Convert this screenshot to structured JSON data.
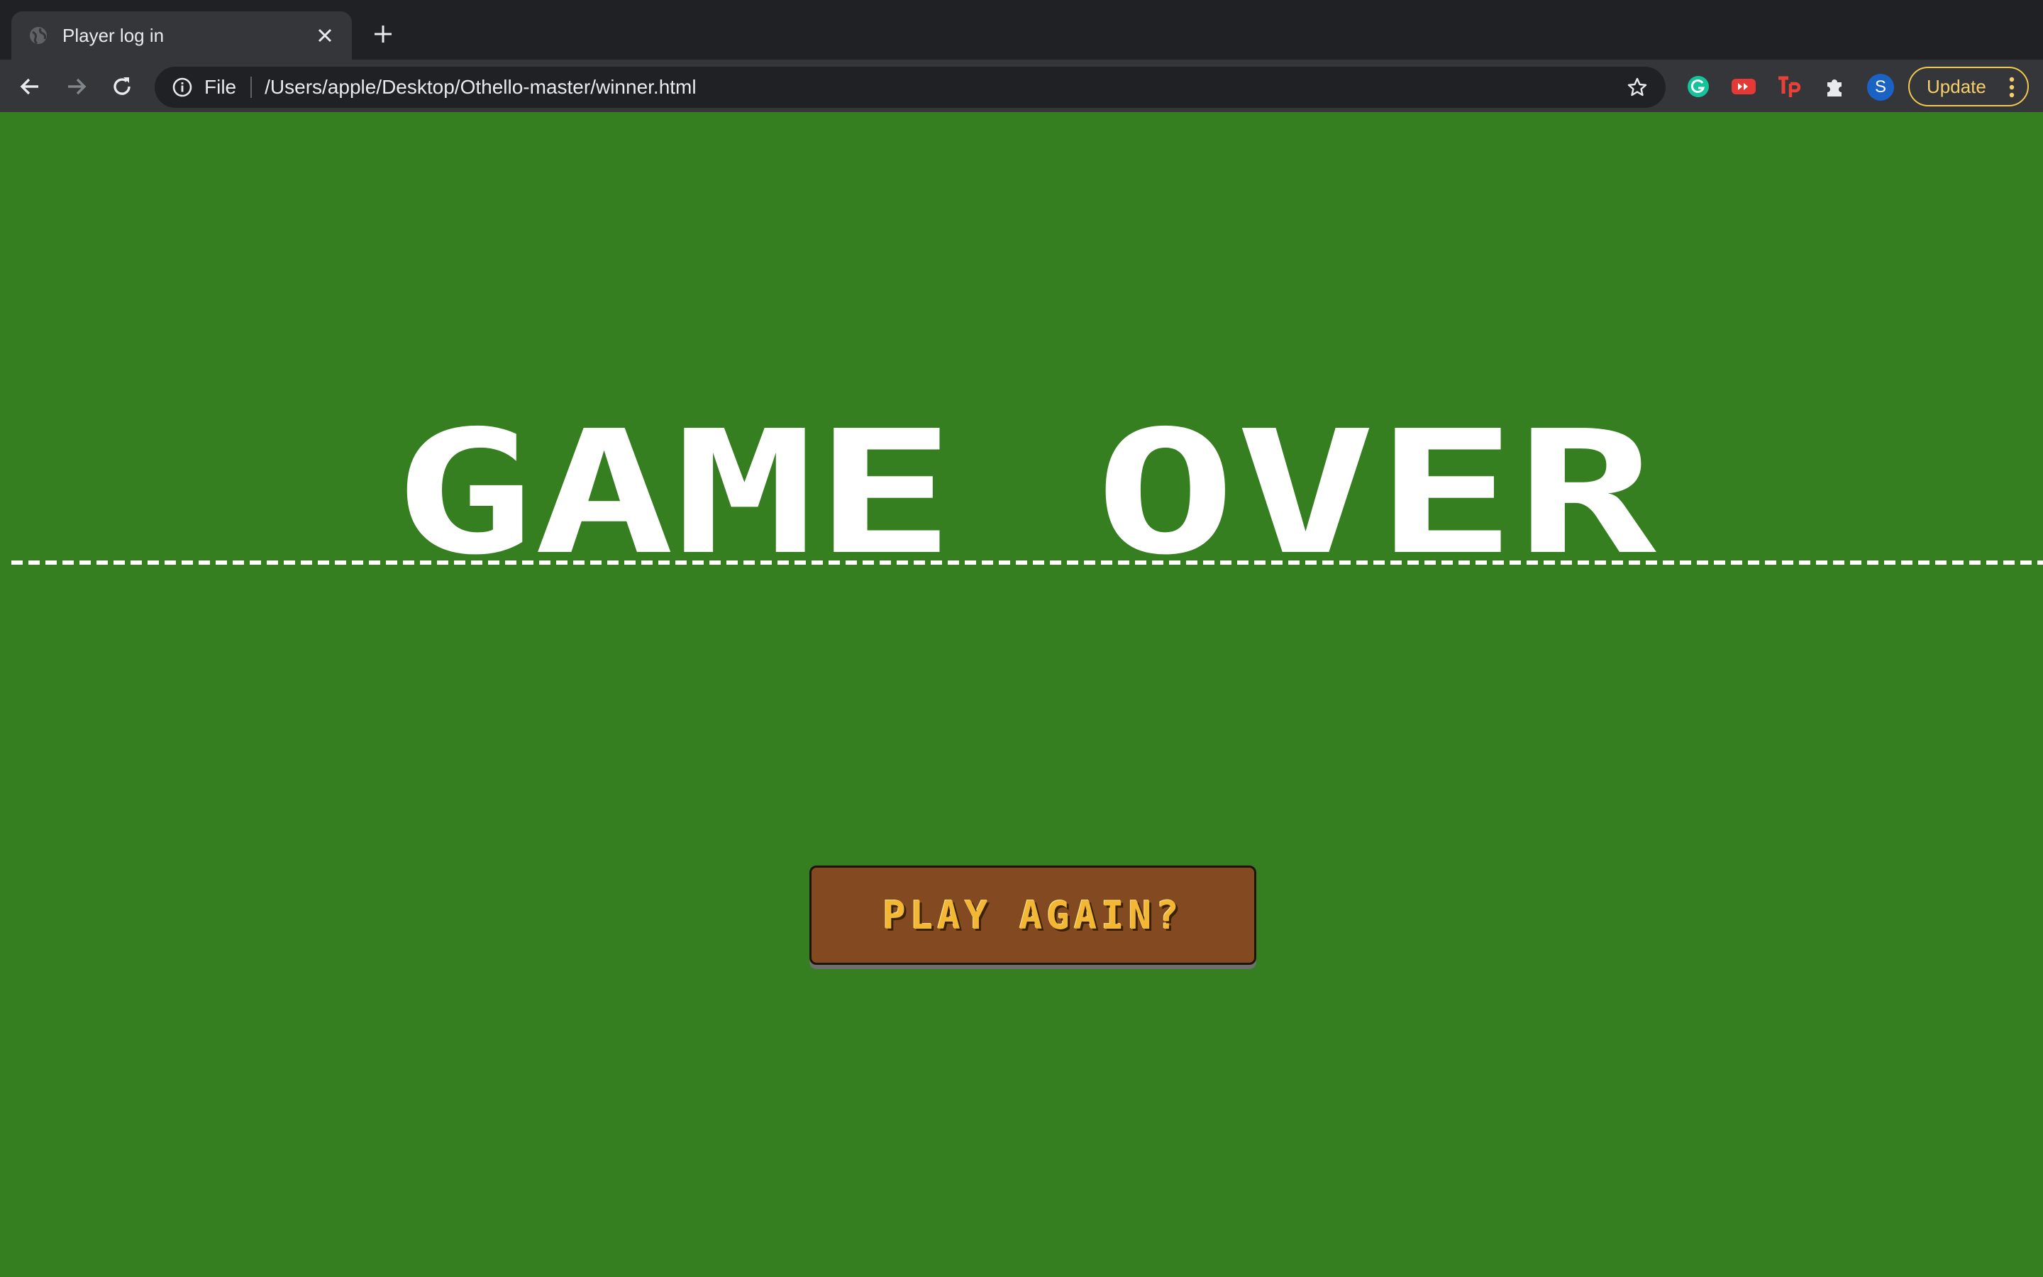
{
  "browser": {
    "tab": {
      "title": "Player log in",
      "favicon": "globe-icon"
    },
    "omnibox": {
      "scheme_label": "File",
      "url": "/Users/apple/Desktop/Othello-master/winner.html"
    },
    "profile_initial": "S",
    "update_label": "Update",
    "extensions": [
      "grammarly-icon",
      "youtube-icon",
      "tp-icon",
      "puzzle-icon"
    ]
  },
  "page": {
    "heading": "GAME OVER",
    "play_again_label": "PLAY AGAIN?"
  },
  "colors": {
    "page_background": "#367F21",
    "heading": "#FFFFFF",
    "button_background": "#834A21",
    "button_text": "#F3B734",
    "update_accent": "#F6CF6A"
  }
}
